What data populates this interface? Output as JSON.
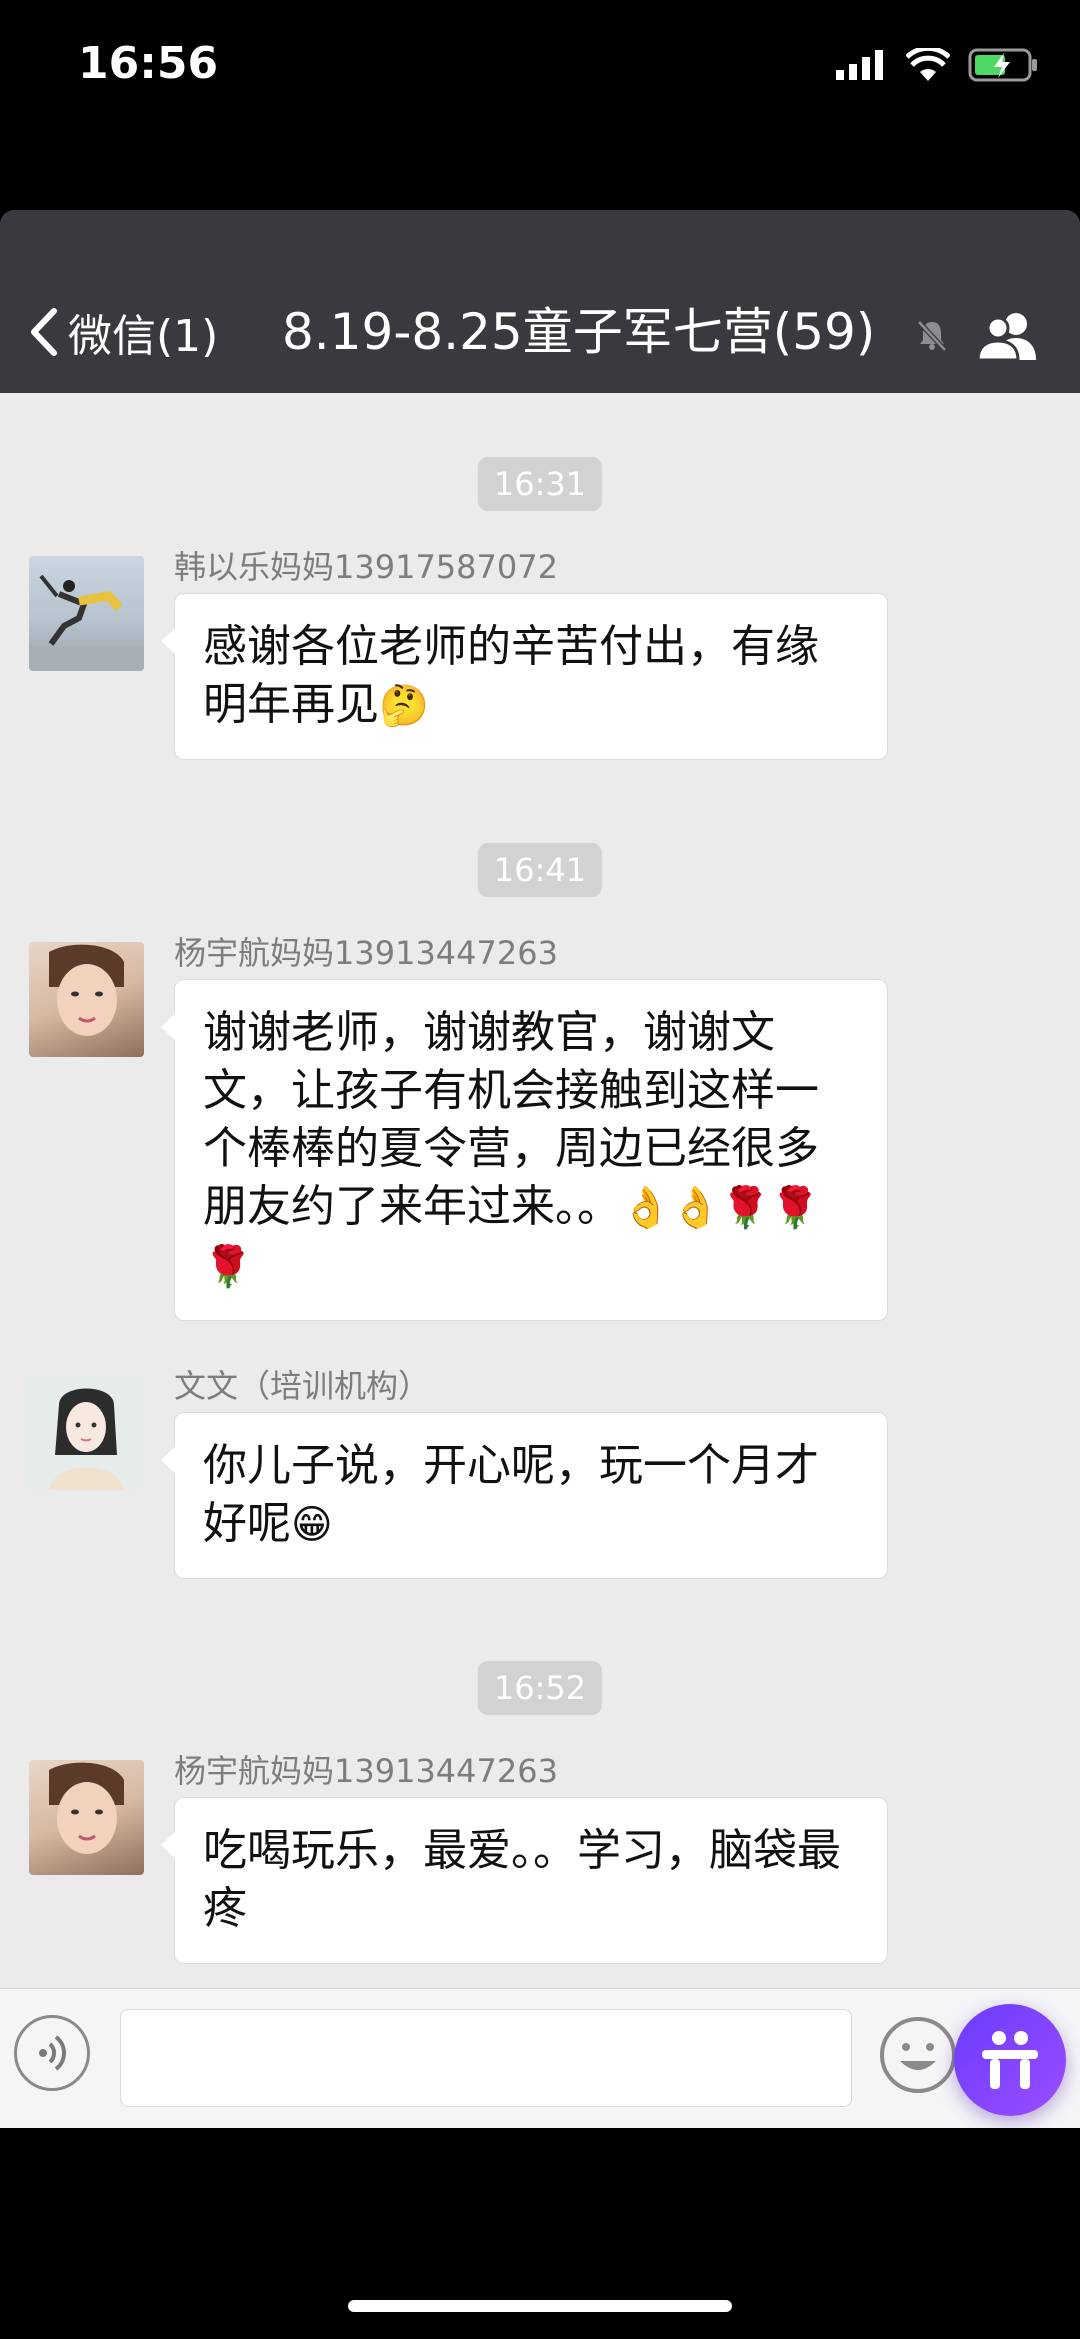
{
  "status": {
    "time": "16:56"
  },
  "nav": {
    "back_label": "微信(1)",
    "title": "8.19-8.25童子军七营(59)"
  },
  "chat": {
    "timestamps": [
      "16:31",
      "16:41",
      "16:52"
    ],
    "messages": [
      {
        "sender": "韩以乐妈妈13917587072",
        "text": "感谢各位老师的辛苦付出，有缘明年再见",
        "emoji": "🤔"
      },
      {
        "sender": "杨宇航妈妈13913447263",
        "text": "谢谢老师，谢谢教官，谢谢文文，让孩子有机会接触到这样一个棒棒的夏令营，周边已经很多朋友约了来年过来。。",
        "emoji": "👌👌🌹🌹🌹"
      },
      {
        "sender": "文文（培训机构）",
        "text": "你儿子说，开心呢，玩一个月才好呢",
        "emoji": "😁"
      },
      {
        "sender": "杨宇航妈妈13913447263",
        "text": "吃喝玩乐，最爱。。学习，脑袋最疼",
        "emoji": ""
      }
    ]
  },
  "input": {
    "placeholder": ""
  },
  "icons": {
    "status": [
      "signal-icon",
      "wifi-icon",
      "battery-charging-icon"
    ],
    "nav": [
      "chevron-left-icon",
      "mute-bell-icon",
      "group-members-icon"
    ],
    "input": [
      "voice-icon",
      "emoji-icon",
      "assistant-fab-icon"
    ]
  },
  "colors": {
    "navbar": "#393a3f",
    "chat_bg": "#ebebeb",
    "bubble": "#ffffff",
    "timestamp_chip": "#d2d2d2"
  }
}
